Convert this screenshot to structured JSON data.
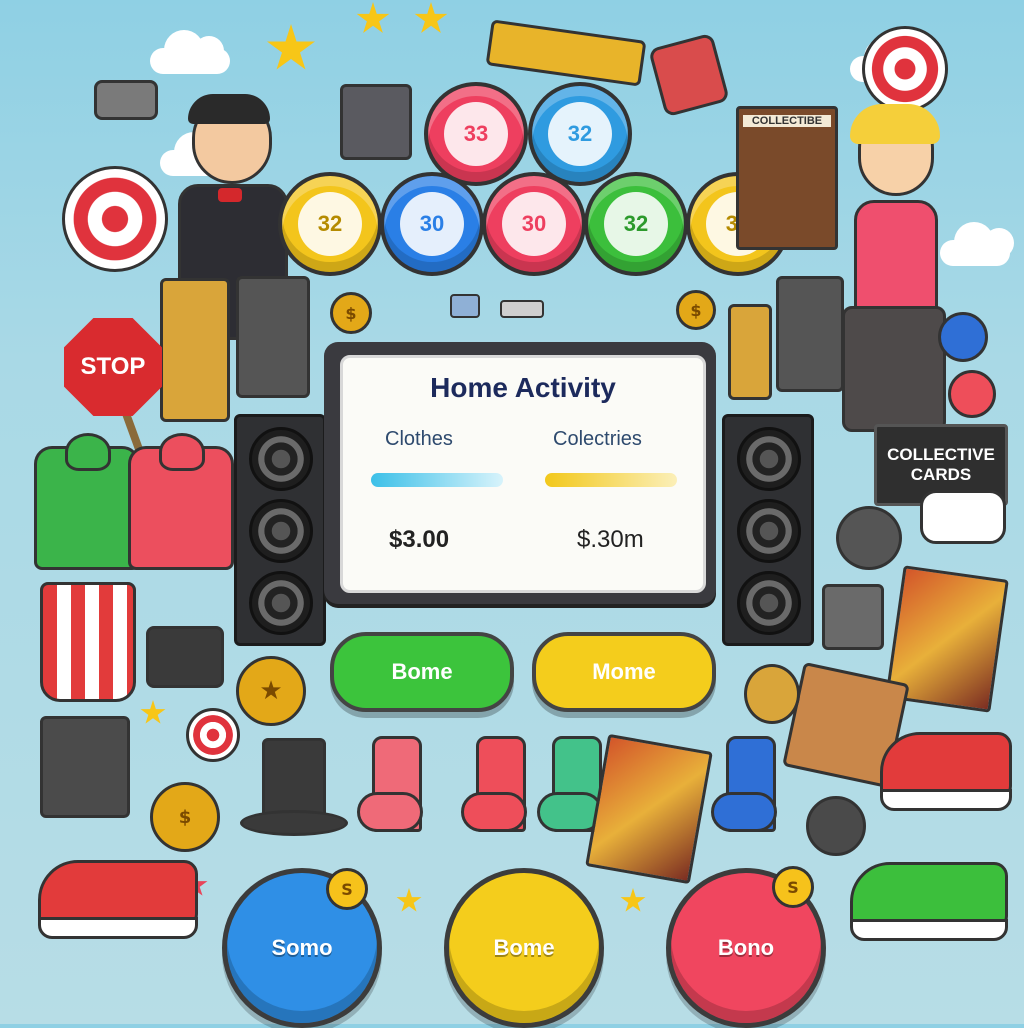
{
  "panel": {
    "title": "Home Activity",
    "columns": [
      {
        "label": "Clothes",
        "price": "$3.00",
        "bar_color": "#3cc0e8"
      },
      {
        "label": "Colectries",
        "price": "$.30m",
        "bar_color": "#f2c81b"
      }
    ]
  },
  "balls_top": [
    {
      "label": "33",
      "color": "#ee3f5f"
    },
    {
      "label": "32",
      "color": "#2f9be0"
    }
  ],
  "balls_row": [
    {
      "label": "32",
      "color": "#f3c51c"
    },
    {
      "label": "30",
      "color": "#2a7fe6"
    },
    {
      "label": "30",
      "color": "#ee3f5f"
    },
    {
      "label": "32",
      "color": "#3cbf3c"
    },
    {
      "label": "30",
      "color": "#f3c51c"
    }
  ],
  "pill_buttons": [
    {
      "label": "Bome",
      "color": "#3cc43c"
    },
    {
      "label": "Mome",
      "color": "#f4cd1c"
    }
  ],
  "round_buttons": [
    {
      "label": "Somo",
      "color": "#2f8fe6",
      "badge": "S"
    },
    {
      "label": "Bome",
      "color": "#f4cd1c",
      "badge": "$"
    },
    {
      "label": "Bono",
      "color": "#f0465f",
      "badge": "S"
    }
  ],
  "signs": {
    "stop": "STOP",
    "collective_cards_line1": "COLLECTIVE",
    "collective_cards_line2": "CARDS",
    "collectible_book": "COLLECTIBE"
  },
  "colors": {
    "background": "#a9d9e6",
    "panel_title": "#1c2a5c"
  }
}
